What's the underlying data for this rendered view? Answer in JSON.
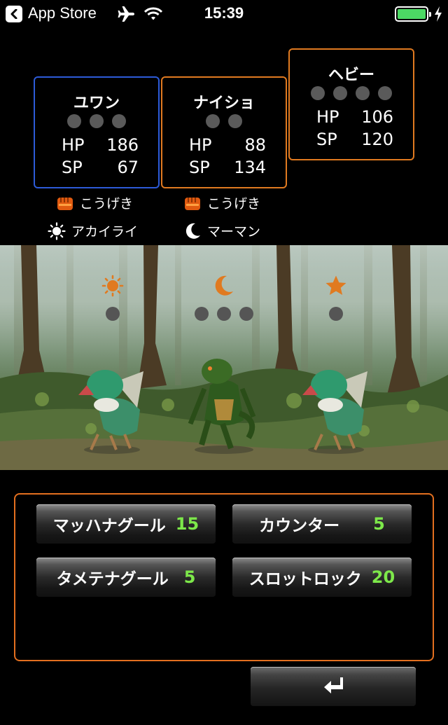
{
  "status_bar": {
    "back_label": "App Store",
    "time": "15:39",
    "battery_level": 1.0,
    "icons": [
      "back-chevron-icon",
      "airplane-icon",
      "wifi-icon",
      "battery-icon",
      "charging-bolt-icon"
    ]
  },
  "party": [
    {
      "name": "ユワン",
      "pips": 3,
      "hp_label": "HP",
      "hp": "186",
      "sp_label": "SP",
      "sp": "67",
      "border_color": "#2d5bd8"
    },
    {
      "name": "ナイショ",
      "pips": 2,
      "hp_label": "HP",
      "hp": "88",
      "sp_label": "SP",
      "sp": "134",
      "border_color": "#e07a20"
    },
    {
      "name": "ヘビー",
      "pips": 4,
      "hp_label": "HP",
      "hp": "106",
      "sp_label": "SP",
      "sp": "120",
      "border_color": "#e07a20"
    }
  ],
  "actions": [
    {
      "label": "こうげき",
      "icon": "fist-icon"
    },
    {
      "label": "こうげき",
      "icon": "fist-icon"
    }
  ],
  "targets": [
    {
      "label": "アカイライ",
      "icon": "sun-icon"
    },
    {
      "label": "マーマン",
      "icon": "moon-icon"
    }
  ],
  "enemies": [
    {
      "marker": "sun-icon",
      "marker_color": "#e07a20",
      "pips": 1
    },
    {
      "marker": "moon-icon",
      "marker_color": "#e07a20",
      "pips": 3
    },
    {
      "marker": "star-icon",
      "marker_color": "#e07a20",
      "pips": 1
    }
  ],
  "skills": [
    {
      "label": "マッハナグール",
      "cost": "15"
    },
    {
      "label": "カウンター",
      "cost": "5"
    },
    {
      "label": "タメテナグール",
      "cost": "5"
    },
    {
      "label": "スロットロック",
      "cost": "20"
    }
  ],
  "return_button": {
    "icon": "return-arrow-icon"
  },
  "colors": {
    "accent_orange": "#e36f1f",
    "cost_green": "#7de84a",
    "selected_blue": "#2d5bd8"
  }
}
